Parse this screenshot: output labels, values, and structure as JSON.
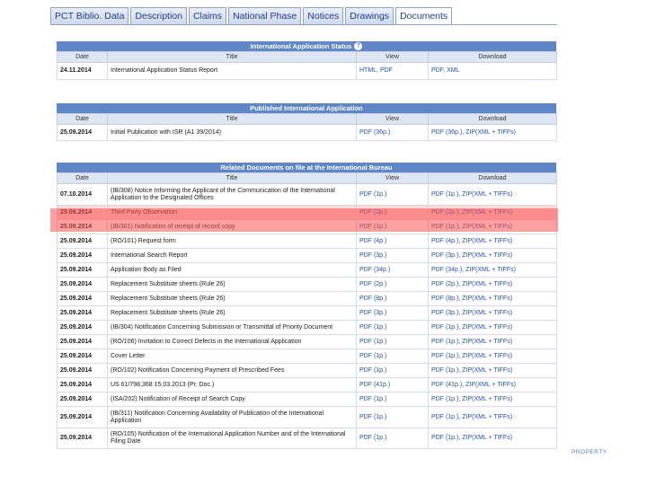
{
  "tabs": [
    "PCT Biblio. Data",
    "Description",
    "Claims",
    "National Phase",
    "Notices",
    "Drawings",
    "Documents"
  ],
  "status": {
    "title": "International Application Status",
    "headers": [
      "Date",
      "Title",
      "View",
      "Download"
    ],
    "rows": [
      {
        "date": "24.11.2014",
        "title": "International Application Status Report",
        "view": "HTML, PDF",
        "download": "PDF, XML"
      }
    ]
  },
  "published": {
    "title": "Published International Application",
    "headers": [
      "Date",
      "Title",
      "View",
      "Download"
    ],
    "rows": [
      {
        "date": "25.09.2014",
        "title": "Initial Publication with ISR (A1 39/2014)",
        "view": "PDF (36p.)",
        "download": "PDF (36p.), ZIP(XML + TIFFs)"
      }
    ]
  },
  "related": {
    "title": "Related Documents on file at the International Bureau",
    "headers": [
      "Date",
      "Title",
      "View",
      "Download"
    ],
    "rows": [
      {
        "date": "07.10.2014",
        "title": "(IB/308) Notice Informing the Applicant of the Communication of the International Application to the Designated Offices",
        "view": "PDF (1p.)",
        "download": "PDF (1p.), ZIP(XML + TIFFs)"
      },
      {
        "date": "29.09.2014",
        "title": "Third Party Observation",
        "view": "PDF (2p.)",
        "download": "PDF (2p.), ZIP(XML + TIFFs)"
      },
      {
        "date": "25.09.2014",
        "title": "(IB/301) Notification of receipt of record copy",
        "view": "PDF (1p.)",
        "download": "PDF (1p.), ZIP(XML + TIFFs)"
      },
      {
        "date": "25.09.2014",
        "title": "(RO/101) Request form",
        "view": "PDF (4p.)",
        "download": "PDF (4p.), ZIP(XML + TIFFs)"
      },
      {
        "date": "25.09.2014",
        "title": "International Search Report",
        "view": "PDF (3p.)",
        "download": "PDF (3p.), ZIP(XML + TIFFs)"
      },
      {
        "date": "25.09.2014",
        "title": "Application Body as Filed",
        "view": "PDF (34p.)",
        "download": "PDF (34p.), ZIP(XML + TIFFs)"
      },
      {
        "date": "25.09.2014",
        "title": "Replacement Substitute sheets (Rule 26)",
        "view": "PDF (2p.)",
        "download": "PDF (2p.), ZIP(XML + TIFFs)"
      },
      {
        "date": "25.09.2014",
        "title": "Replacement Substitute sheets (Rule 26)",
        "view": "PDF (8p.)",
        "download": "PDF (8p.), ZIP(XML + TIFFs)"
      },
      {
        "date": "25.09.2014",
        "title": "Replacement Substitute sheets (Rule 26)",
        "view": "PDF (3p.)",
        "download": "PDF (3p.), ZIP(XML + TIFFs)"
      },
      {
        "date": "25.09.2014",
        "title": "(IB/304) Notification Concerning Submission or Transmittal of Priority Document",
        "view": "PDF (1p.)",
        "download": "PDF (1p.), ZIP(XML + TIFFs)"
      },
      {
        "date": "25.09.2014",
        "title": "(RO/106) Invitation to Correct Defects in the International Application",
        "view": "PDF (1p.)",
        "download": "PDF (1p.), ZIP(XML + TIFFs)"
      },
      {
        "date": "25.09.2014",
        "title": "Cover Letter",
        "view": "PDF (1p.)",
        "download": "PDF (1p.), ZIP(XML + TIFFs)"
      },
      {
        "date": "25.09.2014",
        "title": "(RO/102) Notification Concerning Payment of Prescribed Fees",
        "view": "PDF (1p.)",
        "download": "PDF (1p.), ZIP(XML + TIFFs)"
      },
      {
        "date": "25.09.2014",
        "title": "US 61/798,368 15.03.2013 (Pr. Doc.)",
        "view": "PDF (41p.)",
        "download": "PDF (41p.), ZIP(XML + TIFFs)"
      },
      {
        "date": "25.09.2014",
        "title": "(ISA/202) Notification of Receipt of Search Copy",
        "view": "PDF (1p.)",
        "download": "PDF (1p.), ZIP(XML + TIFFs)"
      },
      {
        "date": "25.09.2014",
        "title": "(IB/311) Notification Concerning Availability of Publication of the International Application",
        "view": "PDF (1p.)",
        "download": "PDF (1p.), ZIP(XML + TIFFs)"
      },
      {
        "date": "25.09.2014",
        "title": "(RO/105) Notification of the International Application Number and of the International Filing Date",
        "view": "PDF (1p.)",
        "download": "PDF (1p.), ZIP(XML + TIFFs)"
      }
    ]
  },
  "footer_text": "PROPERTY"
}
